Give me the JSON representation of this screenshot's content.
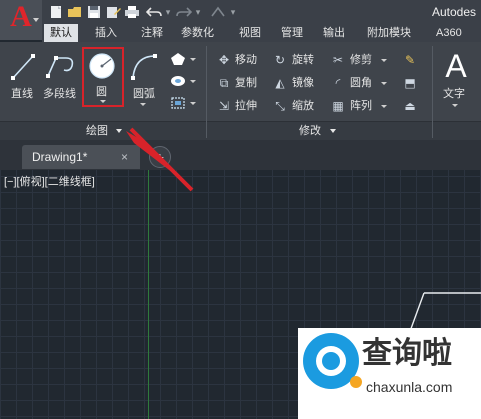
{
  "app": {
    "logo_letter": "A",
    "title": "Autodes",
    "quick_access": [
      "new-icon",
      "open-icon",
      "save-icon",
      "save-as-icon",
      "print-icon",
      "undo-icon",
      "redo-icon",
      "share-icon"
    ]
  },
  "ribbon_tabs": [
    {
      "label": "默认",
      "active": true
    },
    {
      "label": "插入"
    },
    {
      "label": "注释"
    },
    {
      "label": "参数化"
    },
    {
      "label": "视图"
    },
    {
      "label": "管理"
    },
    {
      "label": "输出"
    },
    {
      "label": "附加模块"
    },
    {
      "label": "A360"
    }
  ],
  "draw_panel": {
    "title": "绘图",
    "tools": [
      {
        "label": "直线",
        "icon": "line-icon"
      },
      {
        "label": "多段线",
        "icon": "polyline-icon"
      },
      {
        "label": "圆",
        "icon": "circle-icon"
      },
      {
        "label": "圆弧",
        "icon": "arc-icon"
      }
    ]
  },
  "modify_panel": {
    "title": "修改",
    "tools": [
      {
        "label": "移动",
        "icon": "move-icon"
      },
      {
        "label": "旋转",
        "icon": "rotate-icon"
      },
      {
        "label": "修剪",
        "icon": "trim-icon"
      },
      {
        "label": "复制",
        "icon": "copy-icon"
      },
      {
        "label": "镜像",
        "icon": "mirror-icon"
      },
      {
        "label": "圆角",
        "icon": "fillet-icon"
      },
      {
        "label": "拉伸",
        "icon": "stretch-icon"
      },
      {
        "label": "缩放",
        "icon": "scale-icon"
      },
      {
        "label": "阵列",
        "icon": "array-icon"
      }
    ]
  },
  "annotation_panel": {
    "text_tool": {
      "label": "文字",
      "glyph": "A"
    }
  },
  "document": {
    "tab_label": "Drawing1*",
    "close_glyph": "×",
    "new_tab_glyph": "+"
  },
  "viewport": {
    "label": "[−][俯视][二维线框]"
  },
  "colors": {
    "highlight": "#d8232a",
    "canvas": "#212830",
    "ribbon": "#3f444b",
    "accent": "#e0252b"
  },
  "watermark": {
    "text": "查询啦",
    "url": "chaxunla.com"
  }
}
